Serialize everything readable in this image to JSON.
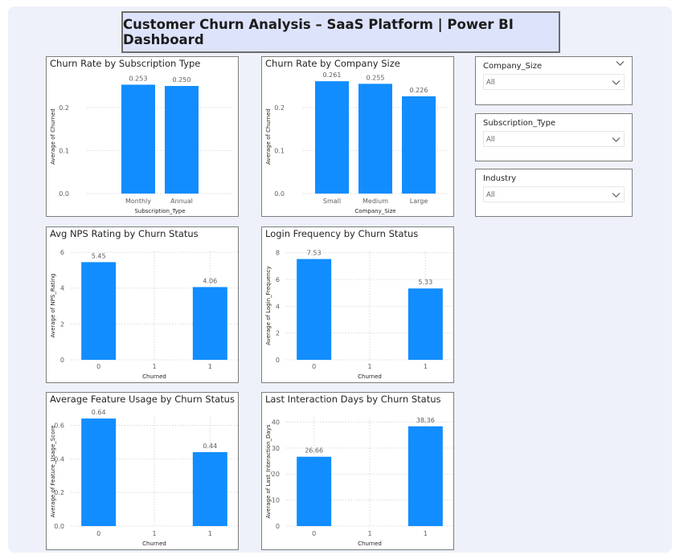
{
  "title": "Customer Churn Analysis – SaaS Platform | Power BI Dashboard",
  "colors": {
    "bar": "#118dff",
    "grid": "#d9d9d9",
    "axis_text": "#605e5c"
  },
  "slicers": [
    {
      "label": "Company_Size",
      "value": "All",
      "header_chevron": true,
      "icon": "chevron-down-icon"
    },
    {
      "label": "Subscription_Type",
      "value": "All",
      "header_chevron": false,
      "icon": "chevron-down-icon"
    },
    {
      "label": "Industry",
      "value": "All",
      "header_chevron": false,
      "icon": "chevron-down-icon"
    }
  ],
  "chart_data": [
    {
      "type": "bar",
      "title": "Churn Rate by Subscription Type",
      "categories": [
        "Monthly",
        "Annual"
      ],
      "values": [
        0.253,
        0.25
      ],
      "data_labels": [
        "0.253",
        "0.250"
      ],
      "xlabel": "Subscription_Type",
      "ylabel": "Average of Churned",
      "ylim": [
        0,
        0.265
      ],
      "yticks": [
        0.0,
        0.1,
        0.2
      ],
      "ytick_labels": [
        "0.0",
        "0.1",
        "0.2"
      ],
      "grid": true
    },
    {
      "type": "bar",
      "title": "Churn Rate by Company Size",
      "categories": [
        "Small",
        "Medium",
        "Large"
      ],
      "values": [
        0.261,
        0.255,
        0.226
      ],
      "data_labels": [
        "0.261",
        "0.255",
        "0.226"
      ],
      "xlabel": "Company_Size",
      "ylabel": "Average of Churned",
      "ylim": [
        0,
        0.265
      ],
      "yticks": [
        0.0,
        0.1,
        0.2
      ],
      "ytick_labels": [
        "0.0",
        "0.1",
        "0.2"
      ],
      "grid": true
    },
    {
      "type": "bar",
      "title": "Avg NPS Rating by Churn Status",
      "categories": [
        "0",
        "1"
      ],
      "bar_slots": [
        0,
        2
      ],
      "slot_labels": [
        "0",
        "1",
        "1"
      ],
      "values": [
        5.45,
        4.06
      ],
      "data_labels": [
        "5.45",
        "4.06"
      ],
      "xlabel": "Churned",
      "ylabel": "Average of NPS_Rating",
      "ylim": [
        0,
        6.05
      ],
      "yticks": [
        0,
        2,
        4,
        6
      ],
      "ytick_labels": [
        "0",
        "2",
        "4",
        "6"
      ],
      "grid": true
    },
    {
      "type": "bar",
      "title": "Login Frequency by Churn Status",
      "categories": [
        "0",
        "1"
      ],
      "bar_slots": [
        0,
        2
      ],
      "slot_labels": [
        "0",
        "1",
        "1"
      ],
      "values": [
        7.53,
        5.33
      ],
      "data_labels": [
        "7.53",
        "5.33"
      ],
      "xlabel": "Churned",
      "ylabel": "Average of Login_Frequency",
      "ylim": [
        0,
        8.1
      ],
      "yticks": [
        0,
        2,
        4,
        6,
        8
      ],
      "ytick_labels": [
        "0",
        "2",
        "4",
        "6",
        "8"
      ],
      "grid": true
    },
    {
      "type": "bar",
      "title": "Average Feature Usage by Churn Status",
      "categories": [
        "0",
        "1"
      ],
      "bar_slots": [
        0,
        2
      ],
      "slot_labels": [
        "0",
        "1",
        "1"
      ],
      "values": [
        0.64,
        0.44
      ],
      "data_labels": [
        "0.64",
        "0.44"
      ],
      "xlabel": "Churned",
      "ylabel": "Average of Feature_Usage_Score",
      "ylim": [
        0,
        0.65
      ],
      "yticks": [
        0,
        0.2,
        0.4,
        0.6
      ],
      "ytick_labels": [
        "0.0",
        "0.2",
        "0.4",
        "0.6"
      ],
      "grid": true
    },
    {
      "type": "bar",
      "title": "Last Interaction Days by Churn Status",
      "categories": [
        "0",
        "1"
      ],
      "bar_slots": [
        0,
        2
      ],
      "slot_labels": [
        "0",
        "1",
        "1"
      ],
      "values": [
        26.66,
        38.36
      ],
      "data_labels": [
        "26.66",
        "38.36"
      ],
      "xlabel": "Churned",
      "ylabel": "Average of Last_Interaction_Days",
      "ylim": [
        0,
        42
      ],
      "yticks": [
        0,
        10,
        20,
        30,
        40
      ],
      "ytick_labels": [
        "0",
        "10",
        "20",
        "30",
        "40"
      ],
      "grid": true
    }
  ]
}
